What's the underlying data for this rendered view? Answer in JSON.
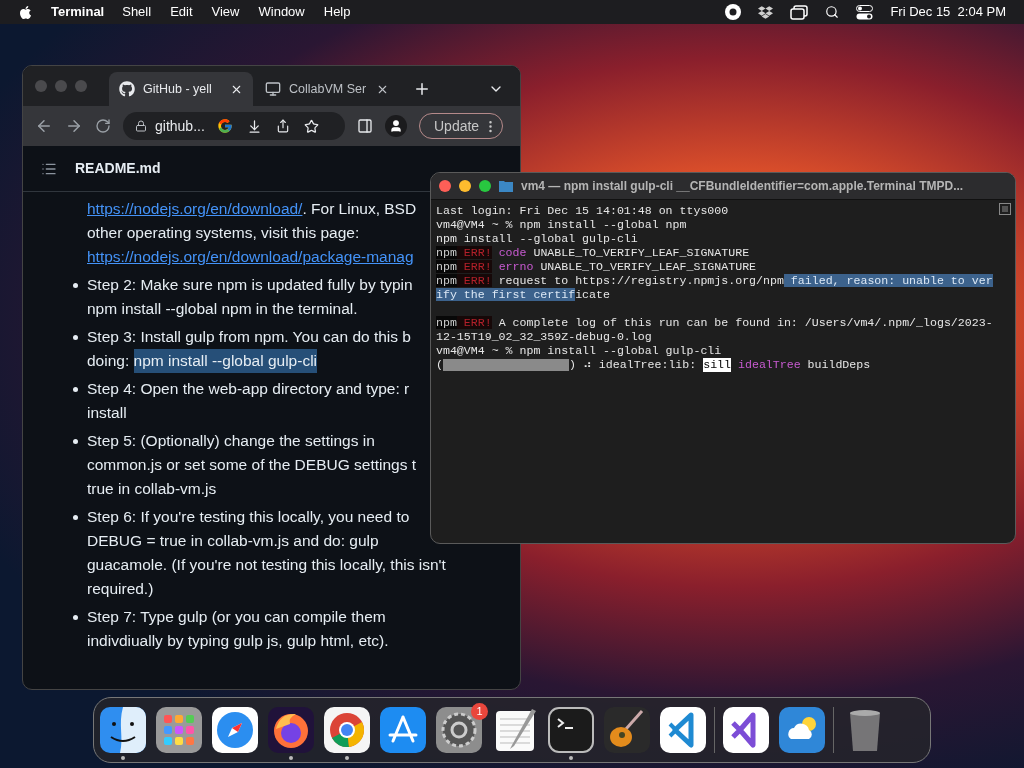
{
  "menu_bar": {
    "app": "Terminal",
    "menus": [
      "Shell",
      "Edit",
      "View",
      "Window",
      "Help"
    ],
    "clock": "Fri Dec 15  2:04 PM"
  },
  "browser": {
    "tabs": [
      {
        "title": "GitHub - yell",
        "selected": true,
        "kind": "github"
      },
      {
        "title": "CollabVM Ser",
        "selected": false,
        "kind": "computer"
      }
    ],
    "address": "github...",
    "update_button": "Update",
    "file_name": "README.md",
    "items": [
      {
        "bullet": false,
        "lines": [
          [
            {
              "text": "https://nodejs.org/en/download/",
              "kind": "link"
            },
            {
              "text": ". For Linux, BSD",
              "kind": "plain"
            }
          ],
          [
            {
              "text": "other operating systems, visit this page:",
              "kind": "plain"
            }
          ],
          [
            {
              "text": "https://nodejs.org/en/download/package-manag",
              "kind": "link"
            }
          ]
        ]
      },
      {
        "bullet": true,
        "lines": [
          [
            {
              "text": "Step 2: Make sure npm is updated fully by typin",
              "kind": "plain"
            }
          ],
          [
            {
              "text": "npm install --global npm in the terminal.",
              "kind": "plain"
            }
          ]
        ]
      },
      {
        "bullet": true,
        "lines": [
          [
            {
              "text": "Step 3: Install gulp from npm. You can do this b",
              "kind": "plain"
            }
          ],
          [
            {
              "text": "doing: ",
              "kind": "plain"
            },
            {
              "text": "npm install --global gulp-cli",
              "kind": "highlight"
            }
          ]
        ]
      },
      {
        "bullet": true,
        "lines": [
          [
            {
              "text": "Step 4: Open the web-app directory and type: r",
              "kind": "plain"
            }
          ],
          [
            {
              "text": "install",
              "kind": "plain"
            }
          ]
        ]
      },
      {
        "bullet": true,
        "lines": [
          [
            {
              "text": "Step 5: (Optionally) change the settings in",
              "kind": "plain"
            }
          ],
          [
            {
              "text": "common.js or set some of the DEBUG settings t",
              "kind": "plain"
            }
          ],
          [
            {
              "text": "true in collab-vm.js",
              "kind": "plain"
            }
          ]
        ]
      },
      {
        "bullet": true,
        "lines": [
          [
            {
              "text": "Step 6: If you're testing this locally, you need to",
              "kind": "plain"
            }
          ],
          [
            {
              "text": "DEBUG = true in collab-vm.js and do: gulp",
              "kind": "plain"
            }
          ],
          [
            {
              "text": "guacamole. (If you're not testing this locally, this isn't",
              "kind": "plain"
            }
          ],
          [
            {
              "text": "required.)",
              "kind": "plain"
            }
          ]
        ]
      },
      {
        "bullet": true,
        "lines": [
          [
            {
              "text": "Step 7: Type gulp (or you can compile them",
              "kind": "plain"
            }
          ],
          [
            {
              "text": "indivdiually by typing gulp js, gulp html, etc).",
              "kind": "plain"
            }
          ]
        ]
      }
    ]
  },
  "terminal": {
    "title": "vm4 — npm install gulp-cli __CFBundleIdentifier=com.apple.Terminal TMPD...",
    "lines": [
      {
        "kind": "text",
        "segments": [
          {
            "text": "Last login: Fri Dec 15 14:01:48 on ttys000",
            "kind": "plain"
          }
        ]
      },
      {
        "kind": "text",
        "segments": [
          {
            "text": "vm4@VM4 ~ % npm install --global npm",
            "kind": "plain"
          }
        ]
      },
      {
        "kind": "text",
        "segments": [
          {
            "text": "npm install --global gulp-cli",
            "kind": "plain"
          }
        ]
      },
      {
        "kind": "text",
        "segments": [
          {
            "text": "npm",
            "kind": "npm"
          },
          {
            "text": " ERR!",
            "kind": "error"
          },
          {
            "text": " code",
            "kind": "keyword"
          },
          {
            "text": " UNABLE_TO_VERIFY_LEAF_SIGNATURE",
            "kind": "plain"
          }
        ]
      },
      {
        "kind": "text",
        "segments": [
          {
            "text": "npm",
            "kind": "npm"
          },
          {
            "text": " ERR!",
            "kind": "error"
          },
          {
            "text": " errno",
            "kind": "keyword"
          },
          {
            "text": " UNABLE_TO_VERIFY_LEAF_SIGNATURE",
            "kind": "plain"
          }
        ]
      },
      {
        "kind": "text",
        "segments": [
          {
            "text": "npm",
            "kind": "npm"
          },
          {
            "text": " ERR!",
            "kind": "error"
          },
          {
            "text": " request to https://registry.npmjs.org/npm",
            "kind": "plain"
          },
          {
            "text": " failed, reason: unable to ver",
            "kind": "selected"
          }
        ]
      },
      {
        "kind": "text",
        "segments": [
          {
            "text": "ify the first certif",
            "kind": "selected"
          },
          {
            "text": "icate",
            "kind": "plain"
          }
        ]
      },
      {
        "kind": "blank"
      },
      {
        "kind": "text",
        "segments": [
          {
            "text": "npm",
            "kind": "npm"
          },
          {
            "text": " ERR!",
            "kind": "error"
          },
          {
            "text": " A complete log of this run can be found in: /Users/vm4/.npm/_logs/2023-",
            "kind": "plain"
          }
        ]
      },
      {
        "kind": "text",
        "segments": [
          {
            "text": "12-15T19_02_32_359Z-debug-0.log",
            "kind": "plain"
          }
        ]
      },
      {
        "kind": "text",
        "segments": [
          {
            "text": "vm4@VM4 ~ % npm install --global gulp-cli",
            "kind": "plain"
          }
        ]
      },
      {
        "kind": "text",
        "segments": [
          {
            "text": "(",
            "kind": "plain"
          },
          {
            "kind": "progress",
            "level": 1
          },
          {
            "text": ") ⠴ idealTree:lib: ",
            "kind": "plain"
          },
          {
            "text": "sill",
            "kind": "inverse"
          },
          {
            "text": " idealTree",
            "kind": "keyword"
          },
          {
            "text": " buildDeps",
            "kind": "plain"
          }
        ]
      }
    ]
  },
  "dock": {
    "sections": [
      {
        "apps": [
          {
            "kind": "finder",
            "running": true
          },
          {
            "kind": "launchpad",
            "running": false
          },
          {
            "kind": "safari",
            "running": false
          },
          {
            "kind": "firefox",
            "running": true
          },
          {
            "kind": "chrome",
            "running": true
          },
          {
            "kind": "appstore",
            "running": false
          },
          {
            "kind": "settings",
            "running": false,
            "badge": "1"
          },
          {
            "kind": "textedit",
            "running": false
          },
          {
            "kind": "terminal",
            "running": true
          },
          {
            "kind": "garageband",
            "running": false
          },
          {
            "kind": "vscode",
            "running": false
          }
        ]
      },
      {
        "apps": [
          {
            "kind": "visualstudio",
            "running": false
          },
          {
            "kind": "weather",
            "running": false
          }
        ]
      },
      {
        "apps": [
          {
            "kind": "trash",
            "running": false
          }
        ]
      }
    ]
  }
}
